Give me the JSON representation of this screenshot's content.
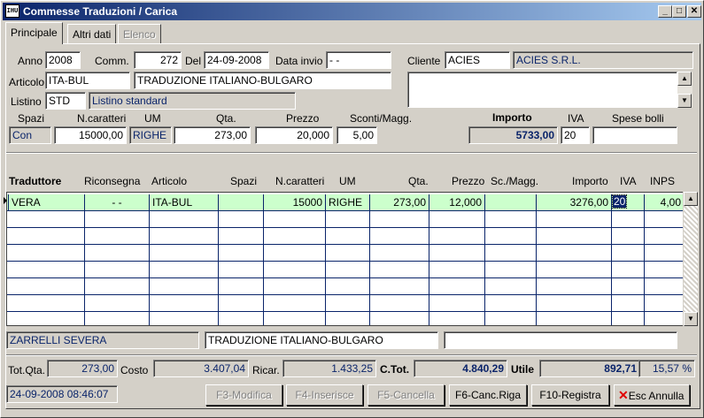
{
  "window": {
    "title": "Commesse Traduzioni / Carica",
    "minimize": "_",
    "maximize": "□",
    "close": "✕",
    "icon_text": "IHU"
  },
  "tabs": [
    {
      "label": "Principale",
      "state": "active"
    },
    {
      "label": "Altri dati",
      "state": "normal"
    },
    {
      "label": "Elenco",
      "state": "disabled"
    }
  ],
  "header": {
    "anno_label": "Anno",
    "anno": "2008",
    "comm_label": "Comm.",
    "comm": "272",
    "del_label": "Del",
    "del": "24-09-2008",
    "data_invio_label": "Data invio",
    "data_invio": "- -",
    "cliente_label": "Cliente",
    "cliente_code": "ACIES",
    "cliente_name": "ACIES S.R.L.",
    "articolo_label": "Articolo",
    "articolo_code": "ITA-BUL",
    "articolo_desc": "TRADUZIONE ITALIANO-BULGARO",
    "listino_label": "Listino",
    "listino_code": "STD",
    "listino_desc": "Listino standard"
  },
  "summary_labels": {
    "spazi": "Spazi",
    "ncaratteri": "N.caratteri",
    "um": "UM",
    "qta": "Qta.",
    "prezzo": "Prezzo",
    "sconti": "Sconti/Magg.",
    "importo": "Importo",
    "iva": "IVA",
    "spese_bolli": "Spese bolli"
  },
  "summary_values": {
    "spazi": "Con",
    "ncaratteri": "15000,00",
    "um": "RIGHE",
    "qta": "273,00",
    "prezzo": "20,000",
    "sconti": "5,00",
    "importo": "5733,00",
    "iva": "20",
    "spese_bolli": ""
  },
  "grid": {
    "columns": [
      "Traduttore",
      "Riconsegna",
      "Articolo",
      "Spazi",
      "N.caratteri",
      "UM",
      "Qta.",
      "Prezzo",
      "Sc./Magg.",
      "Importo",
      "IVA",
      "INPS"
    ],
    "rows": [
      {
        "traduttore": "VERA",
        "riconsegna": "- -",
        "articolo": "ITA-BUL",
        "spazi": "",
        "ncaratteri": "15000",
        "um": "RIGHE",
        "qta": "273,00",
        "prezzo": "12,000",
        "scmagg": "",
        "importo": "3276,00",
        "iva": "20",
        "inps": "4,00"
      }
    ],
    "empty_row_count": 7,
    "selected_color": "#ccffcc"
  },
  "footer_fields": {
    "traduttore_name": "ZARRELLI SEVERA",
    "articolo_desc": "TRADUZIONE ITALIANO-BULGARO",
    "note": ""
  },
  "totals": {
    "tot_qta_label": "Tot.Qta.",
    "tot_qta": "273,00",
    "costo_label": "Costo",
    "costo": "3.407,04",
    "ricar_label": "Ricar.",
    "ricar": "1.433,25",
    "ctot_label": "C.Tot.",
    "ctot": "4.840,29",
    "utile_label": "Utile",
    "utile": "892,71",
    "percent": "15,57 %"
  },
  "status": {
    "datetime": "24-09-2008 08:46:07"
  },
  "buttons": {
    "f3": "F3-Modifica",
    "f4": "F4-Inserisce",
    "f5": "F5-Cancella",
    "f6": "F6-Canc.Riga",
    "f10": "F10-Registra",
    "esc": "Esc Annulla"
  }
}
